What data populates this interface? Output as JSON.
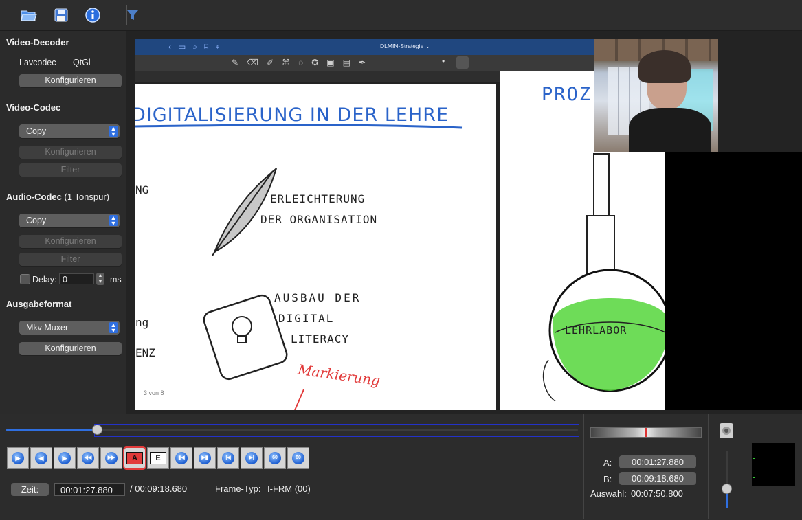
{
  "toolbar": {
    "icons": [
      "open-folder-icon",
      "save-icon",
      "info-icon",
      "filter-icon"
    ]
  },
  "sidebar": {
    "video_decoder": {
      "title": "Video-Decoder",
      "opt1": "Lavcodec",
      "opt2": "QtGl",
      "configure": "Konfigurieren"
    },
    "video_codec": {
      "title": "Video-Codec",
      "selected": "Copy",
      "configure": "Konfigurieren",
      "filter": "Filter"
    },
    "audio_codec": {
      "title": "Audio-Codec",
      "tracks": "(1 Tonspur)",
      "selected": "Copy",
      "configure": "Konfigurieren",
      "filter": "Filter",
      "delay_label": "Delay:",
      "delay_value": "0",
      "delay_unit": "ms"
    },
    "output": {
      "title": "Ausgabeformat",
      "selected": "Mkv Muxer",
      "configure": "Konfigurieren"
    }
  },
  "video": {
    "app_title": "DLMIN-Strategie",
    "app_title_chevron": "⌄",
    "page1": {
      "heading": "DIGITALISIERUNG IN DER LEHRE",
      "item1_line1": "ERLEICHTERUNG",
      "item1_line2": "DER ORGANISATION",
      "item2_line1": "AUSBAU DER",
      "item2_line2": "DIGITAL",
      "item2_line3": "LITERACY",
      "left_frag1": "NG",
      "left_frag2": "ng",
      "left_frag3": "ENZ",
      "page_counter": "3 von 8"
    },
    "page2": {
      "heading": "PROZ",
      "flask_label": "LEHRLABOR"
    },
    "annotation": "Markierung"
  },
  "bottom": {
    "seek": {
      "progress": 0.16
    },
    "nav_buttons": [
      {
        "name": "play-button",
        "glyph": "▶"
      },
      {
        "name": "previous-frame-button",
        "glyph": "◀"
      },
      {
        "name": "next-frame-button",
        "glyph": "▶"
      },
      {
        "name": "rewind-button",
        "glyph": "◀◀"
      },
      {
        "name": "fast-forward-button",
        "glyph": "▶▶"
      },
      {
        "name": "set-marker-a-button",
        "glyph": "A"
      },
      {
        "name": "set-marker-b-button",
        "glyph": "E"
      },
      {
        "name": "previous-keyframe-button",
        "glyph": "▮◀"
      },
      {
        "name": "next-keyframe-button",
        "glyph": "▶▮"
      },
      {
        "name": "goto-marker-a-button",
        "glyph": "|◀"
      },
      {
        "name": "goto-marker-b-button",
        "glyph": "▶|"
      },
      {
        "name": "back-60-button",
        "glyph": "60"
      },
      {
        "name": "forward-60-button",
        "glyph": "60"
      }
    ],
    "time": {
      "label": "Zeit:",
      "current": "00:01:27.880",
      "total": "/ 00:09:18.680",
      "frame_type_label": "Frame-Typ:",
      "frame_type_value": "I-FRM (00)"
    },
    "markers": {
      "a_label": "A:",
      "a_value": "00:01:27.880",
      "b_label": "B:",
      "b_value": "00:09:18.680",
      "selection_label": "Auswahl:",
      "selection_value": "00:07:50.800"
    },
    "volume": {
      "level": 0.35
    }
  },
  "colors": {
    "accent": "#2f6fe0",
    "annotation_red": "#e23b3b",
    "ink_blue": "#2a63c9",
    "flask_green": "#55d63b"
  }
}
